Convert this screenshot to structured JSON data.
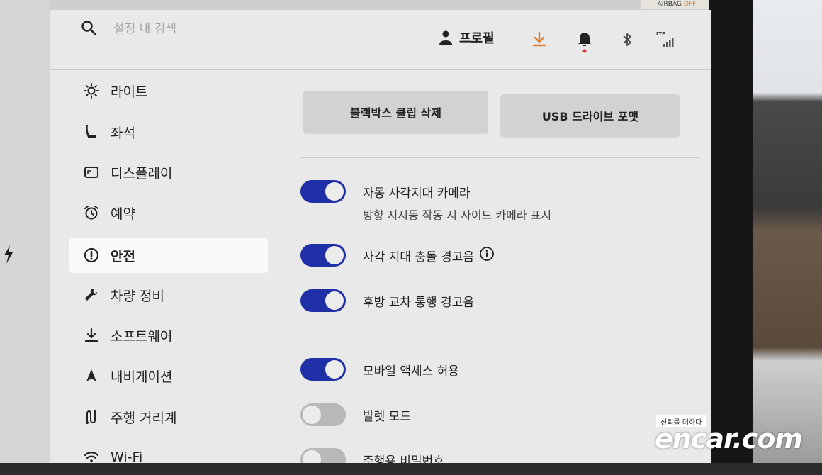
{
  "status_strip": {
    "airbag_prefix": "AIRBAG",
    "airbag_state": "OFF"
  },
  "topbar": {
    "search_placeholder": "설정 내 검색",
    "profile_label": "프로필",
    "lte_label": "LTE",
    "download_color": "#e07a30",
    "notification_dot_color": "#d32f2f"
  },
  "sidebar": {
    "items": [
      {
        "label": "라이트",
        "icon": "sun-icon"
      },
      {
        "label": "좌석",
        "icon": "seat-icon"
      },
      {
        "label": "디스플레이",
        "icon": "display-icon"
      },
      {
        "label": "예약",
        "icon": "alarm-clock-icon"
      },
      {
        "label": "안전",
        "icon": "alert-circle-icon",
        "active": true
      },
      {
        "label": "차량 정비",
        "icon": "wrench-icon"
      },
      {
        "label": "소프트웨어",
        "icon": "download-icon"
      },
      {
        "label": "내비게이션",
        "icon": "navigation-arrow-icon"
      },
      {
        "label": "주행 거리계",
        "icon": "trip-route-icon"
      },
      {
        "label": "Wi-Fi",
        "icon": "wifi-icon"
      }
    ]
  },
  "main": {
    "buttons": {
      "delete_dashcam": "블랙박스 클립 삭제",
      "format_usb": "USB 드라이브 포맷"
    },
    "toggles": [
      {
        "label": "자동 사각지대 카메라",
        "sub": "방향 지시등 작동 시 사이드 카메라 표시",
        "on": true
      },
      {
        "label": "사각 지대 충돌 경고음",
        "on": true,
        "info": true
      },
      {
        "label": "후방 교차 통행 경고음",
        "on": true
      },
      {
        "label": "모바일 액세스 허용",
        "on": true
      },
      {
        "label": "발렛 모드",
        "on": false
      },
      {
        "label": "주행용 비밀번호",
        "on": false
      }
    ],
    "toggle_on_color": "#1f2fa6"
  },
  "watermark": {
    "tag": "신뢰를 더하다",
    "brand": "encar.com"
  }
}
